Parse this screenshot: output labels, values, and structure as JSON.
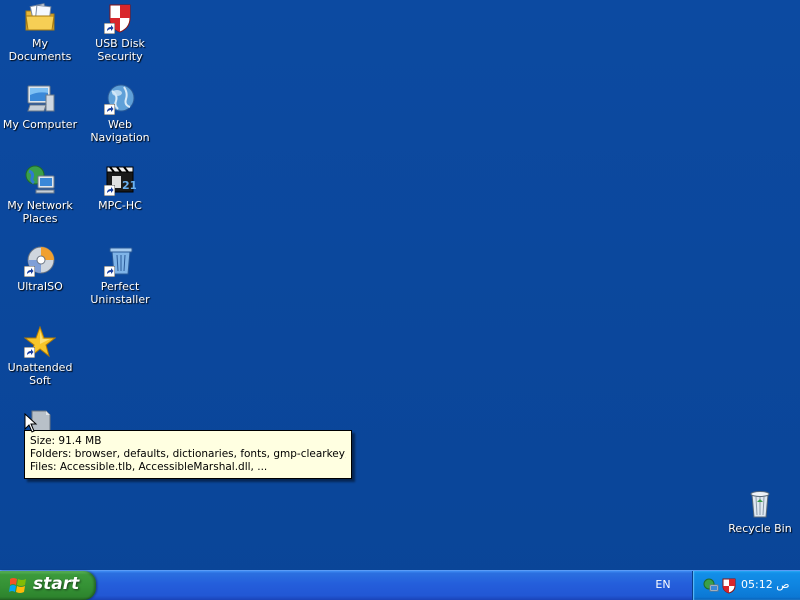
{
  "desktop": {
    "icons": [
      {
        "label": "My Documents",
        "icon": "my-documents-icon",
        "shortcut": false
      },
      {
        "label": "USB Disk Security",
        "icon": "usb-disk-security-icon",
        "shortcut": true
      },
      {
        "label": "My Computer",
        "icon": "my-computer-icon",
        "shortcut": false
      },
      {
        "label": "Web Navigation",
        "icon": "web-navigation-icon",
        "shortcut": true
      },
      {
        "label": "My Network Places",
        "icon": "network-places-icon",
        "shortcut": false
      },
      {
        "label": "MPC-HC",
        "icon": "mpc-hc-icon",
        "shortcut": true
      },
      {
        "label": "UltraISO",
        "icon": "ultraiso-icon",
        "shortcut": true
      },
      {
        "label": "Perfect Uninstaller",
        "icon": "perfect-uninstaller-icon",
        "shortcut": true
      },
      {
        "label": "Unattended Soft",
        "icon": "unattended-soft-icon",
        "shortcut": true
      },
      {
        "label": "",
        "icon": "folder-icon",
        "shortcut": false
      },
      {
        "label": "Recycle Bin",
        "icon": "recycle-bin-icon",
        "shortcut": false
      }
    ],
    "background_color": "#0b4a9e"
  },
  "tooltip": {
    "size_line": "Size: 91.4 MB",
    "folders_line": "Folders: browser, defaults, dictionaries, fonts, gmp-clearkey, ...",
    "files_line": "Files: Accessible.tlb, AccessibleMarshal.dll, ..."
  },
  "taskbar": {
    "start_label": "start",
    "language": "EN",
    "tray_icons": [
      "network-tray-icon",
      "usb-security-tray-icon"
    ],
    "clock": "05:12 ص"
  }
}
